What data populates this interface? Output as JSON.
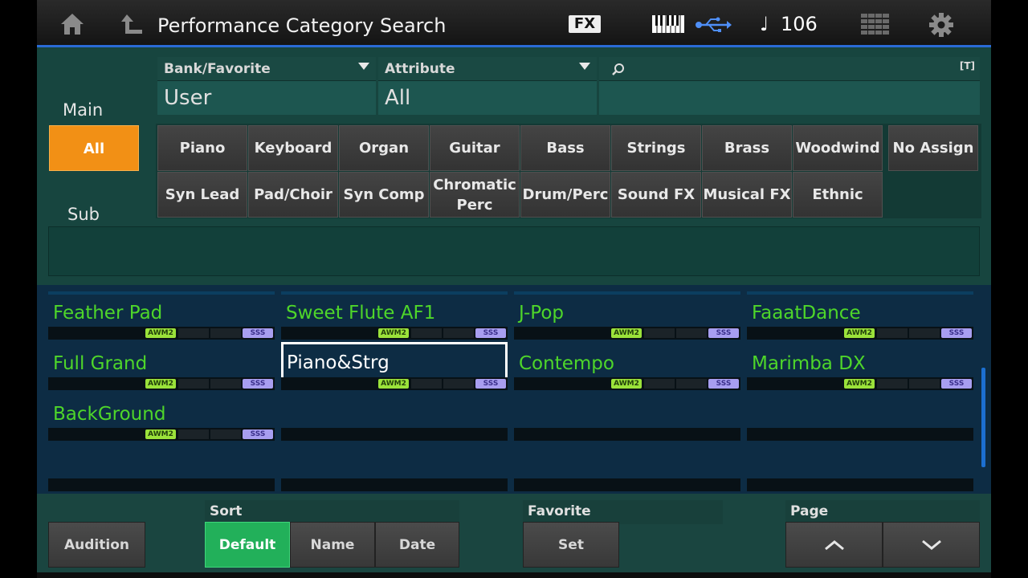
{
  "header": {
    "title": "Performance Category Search",
    "fx_label": "FX",
    "tempo": "106",
    "note_glyph": "♩"
  },
  "filters": {
    "bank": {
      "label": "Bank/Favorite",
      "value": "User"
    },
    "attribute": {
      "label": "Attribute",
      "value": "All"
    },
    "search": {
      "value": "",
      "text_mode_label": "[T]"
    }
  },
  "categories": {
    "main_label": "Main",
    "sub_label": "Sub",
    "all_label": "All",
    "row1": [
      "Piano",
      "Keyboard",
      "Organ",
      "Guitar",
      "Bass",
      "Strings",
      "Brass",
      "Woodwind",
      "No Assign"
    ],
    "row2": [
      "Syn Lead",
      "Pad/Choir",
      "Syn Comp",
      "Chromatic Perc",
      "Drum/Perc",
      "Sound FX",
      "Musical FX",
      "Ethnic"
    ]
  },
  "performances": [
    {
      "name": "Feather Pad",
      "awm": "AWM2",
      "sss": "SSS",
      "selected": false
    },
    {
      "name": "Sweet Flute AF1",
      "awm": "AWM2",
      "sss": "SSS",
      "selected": false
    },
    {
      "name": "J-Pop",
      "awm": "AWM2",
      "sss": "SSS",
      "selected": false
    },
    {
      "name": "FaaatDance",
      "awm": "AWM2",
      "sss": "SSS",
      "selected": false
    },
    {
      "name": "Full Grand",
      "awm": "AWM2",
      "sss": "SSS",
      "selected": false
    },
    {
      "name": "Piano&Strg",
      "awm": "AWM2",
      "sss": "SSS",
      "selected": true
    },
    {
      "name": "Contempo",
      "awm": "AWM2",
      "sss": "SSS",
      "selected": false
    },
    {
      "name": "Marimba DX",
      "awm": "AWM2",
      "sss": "SSS",
      "selected": false
    },
    {
      "name": "BackGround",
      "awm": "AWM2",
      "sss": "SSS",
      "selected": false
    }
  ],
  "bottom": {
    "audition": "Audition",
    "sort_label": "Sort",
    "sort_options": [
      "Default",
      "Name",
      "Date"
    ],
    "sort_selected": "Default",
    "favorite_label": "Favorite",
    "favorite_set": "Set",
    "page_label": "Page",
    "page_up": "︿",
    "page_down": "﹀"
  },
  "colors": {
    "accent": "#f29015",
    "selected_sort": "#22b05a",
    "perf_name": "#4ed62a",
    "title_line": "#2a6bd6"
  }
}
